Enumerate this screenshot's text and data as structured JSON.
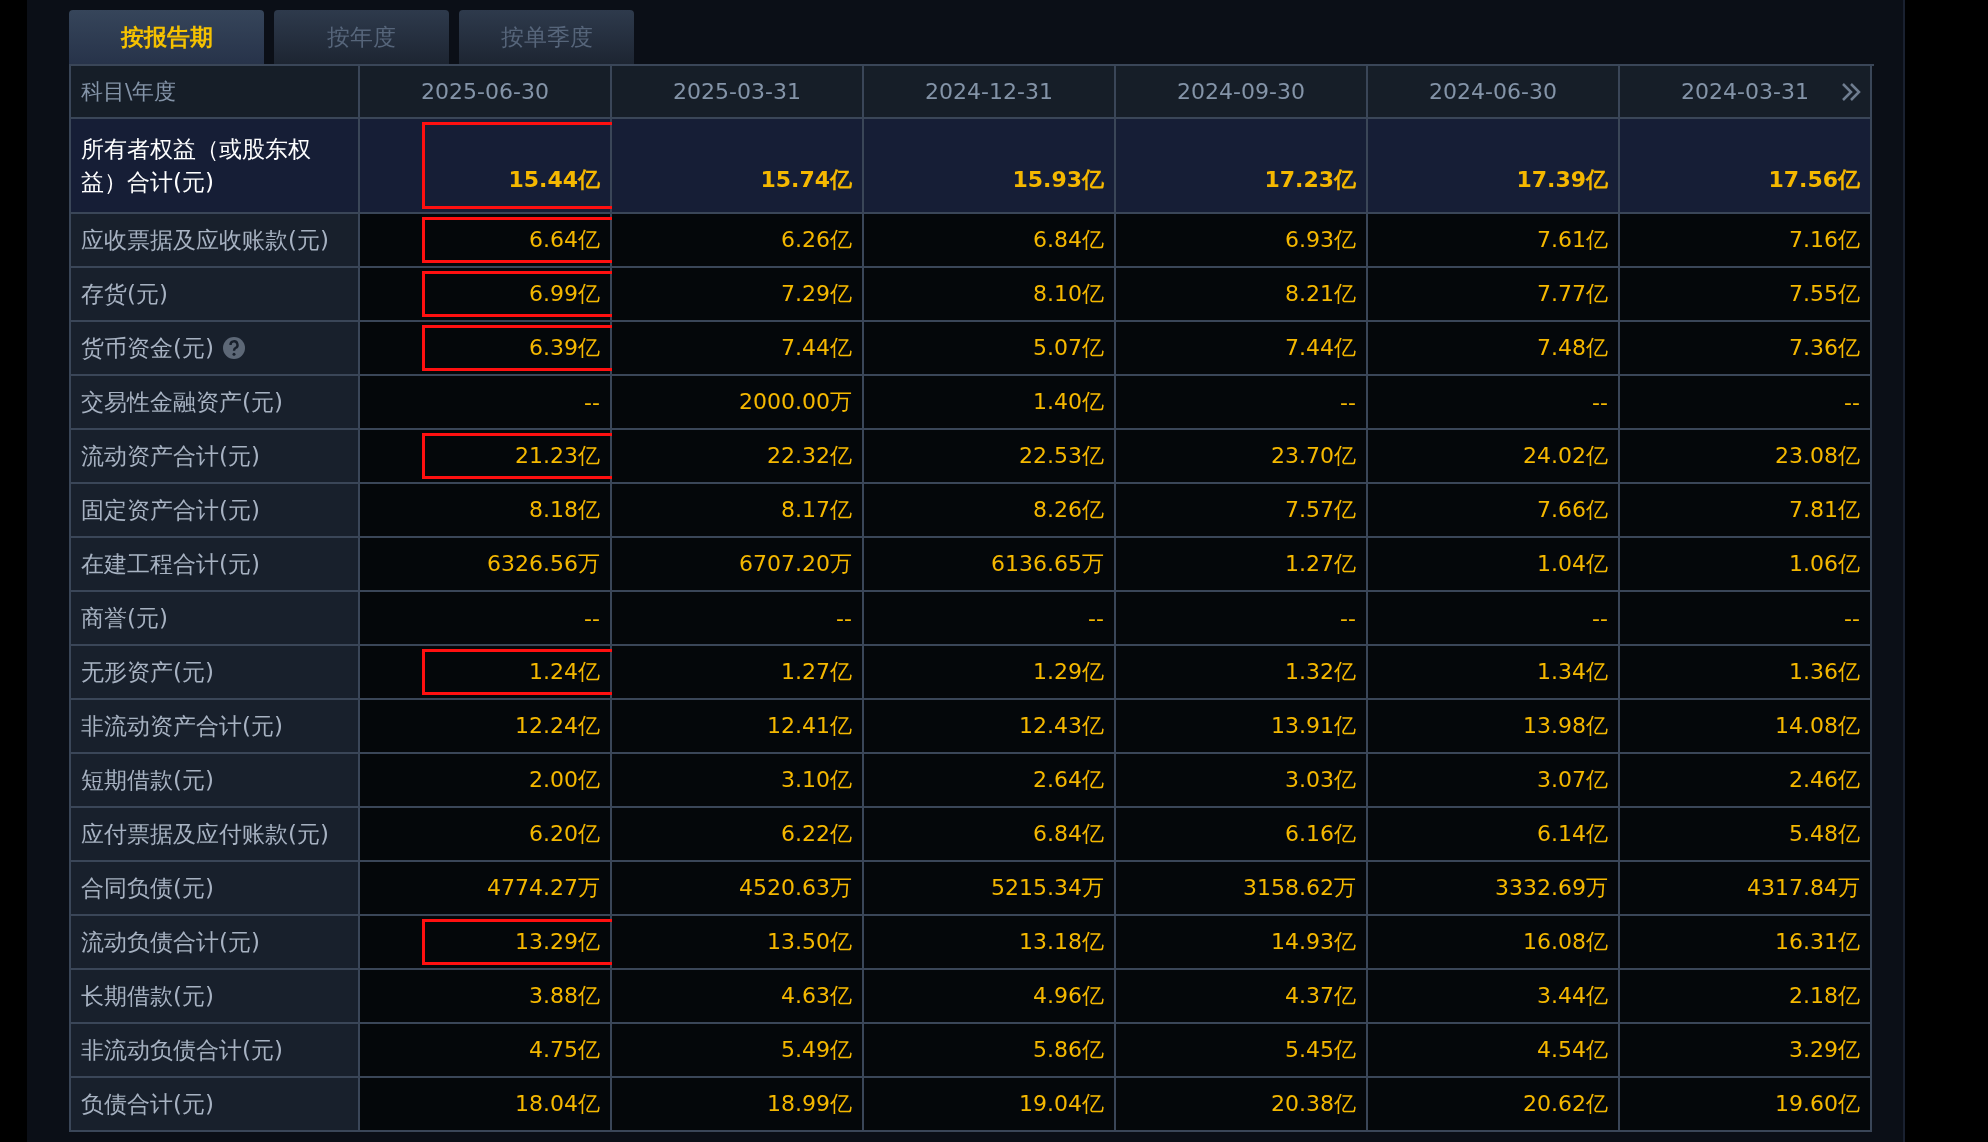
{
  "tabs": [
    {
      "label": "按报告期",
      "selected": true
    },
    {
      "label": "按年度",
      "selected": false
    },
    {
      "label": "按单季度",
      "selected": false
    }
  ],
  "table": {
    "corner": "科目\\年度",
    "columns": [
      "2025-06-30",
      "2025-03-31",
      "2024-12-31",
      "2024-09-30",
      "2024-06-30",
      "2024-03-31"
    ],
    "rows": [
      {
        "kind": "total",
        "label": "所有者权益（或股东权益）合计(元)",
        "help": false,
        "cells": [
          {
            "text": "15.44亿",
            "boxed": true
          },
          {
            "text": "15.74亿",
            "boxed": false
          },
          {
            "text": "15.93亿",
            "boxed": false
          },
          {
            "text": "17.23亿",
            "boxed": false
          },
          {
            "text": "17.39亿",
            "boxed": false
          },
          {
            "text": "17.56亿",
            "boxed": false
          }
        ]
      },
      {
        "kind": "item",
        "label": "应收票据及应收账款(元)",
        "help": false,
        "cells": [
          {
            "text": "6.64亿",
            "boxed": true
          },
          {
            "text": "6.26亿",
            "boxed": false
          },
          {
            "text": "6.84亿",
            "boxed": false
          },
          {
            "text": "6.93亿",
            "boxed": false
          },
          {
            "text": "7.61亿",
            "boxed": false
          },
          {
            "text": "7.16亿",
            "boxed": false
          }
        ]
      },
      {
        "kind": "item",
        "label": "存货(元)",
        "help": false,
        "cells": [
          {
            "text": "6.99亿",
            "boxed": true
          },
          {
            "text": "7.29亿",
            "boxed": false
          },
          {
            "text": "8.10亿",
            "boxed": false
          },
          {
            "text": "8.21亿",
            "boxed": false
          },
          {
            "text": "7.77亿",
            "boxed": false
          },
          {
            "text": "7.55亿",
            "boxed": false
          }
        ]
      },
      {
        "kind": "item",
        "label": "货币资金(元)",
        "help": true,
        "cells": [
          {
            "text": "6.39亿",
            "boxed": true
          },
          {
            "text": "7.44亿",
            "boxed": false
          },
          {
            "text": "5.07亿",
            "boxed": false
          },
          {
            "text": "7.44亿",
            "boxed": false
          },
          {
            "text": "7.48亿",
            "boxed": false
          },
          {
            "text": "7.36亿",
            "boxed": false
          }
        ]
      },
      {
        "kind": "item",
        "label": "交易性金融资产(元)",
        "help": false,
        "cells": [
          {
            "text": "--",
            "boxed": false
          },
          {
            "text": "2000.00万",
            "boxed": false
          },
          {
            "text": "1.40亿",
            "boxed": false
          },
          {
            "text": "--",
            "boxed": false
          },
          {
            "text": "--",
            "boxed": false
          },
          {
            "text": "--",
            "boxed": false
          }
        ]
      },
      {
        "kind": "item",
        "label": "流动资产合计(元)",
        "help": false,
        "cells": [
          {
            "text": "21.23亿",
            "boxed": true
          },
          {
            "text": "22.32亿",
            "boxed": false
          },
          {
            "text": "22.53亿",
            "boxed": false
          },
          {
            "text": "23.70亿",
            "boxed": false
          },
          {
            "text": "24.02亿",
            "boxed": false
          },
          {
            "text": "23.08亿",
            "boxed": false
          }
        ]
      },
      {
        "kind": "item",
        "label": "固定资产合计(元)",
        "help": false,
        "cells": [
          {
            "text": "8.18亿",
            "boxed": false
          },
          {
            "text": "8.17亿",
            "boxed": false
          },
          {
            "text": "8.26亿",
            "boxed": false
          },
          {
            "text": "7.57亿",
            "boxed": false
          },
          {
            "text": "7.66亿",
            "boxed": false
          },
          {
            "text": "7.81亿",
            "boxed": false
          }
        ]
      },
      {
        "kind": "item",
        "label": "在建工程合计(元)",
        "help": false,
        "cells": [
          {
            "text": "6326.56万",
            "boxed": false
          },
          {
            "text": "6707.20万",
            "boxed": false
          },
          {
            "text": "6136.65万",
            "boxed": false
          },
          {
            "text": "1.27亿",
            "boxed": false
          },
          {
            "text": "1.04亿",
            "boxed": false
          },
          {
            "text": "1.06亿",
            "boxed": false
          }
        ]
      },
      {
        "kind": "item",
        "label": "商誉(元)",
        "help": false,
        "cells": [
          {
            "text": "--",
            "boxed": false
          },
          {
            "text": "--",
            "boxed": false
          },
          {
            "text": "--",
            "boxed": false
          },
          {
            "text": "--",
            "boxed": false
          },
          {
            "text": "--",
            "boxed": false
          },
          {
            "text": "--",
            "boxed": false
          }
        ]
      },
      {
        "kind": "item",
        "label": "无形资产(元)",
        "help": false,
        "cells": [
          {
            "text": "1.24亿",
            "boxed": true
          },
          {
            "text": "1.27亿",
            "boxed": false
          },
          {
            "text": "1.29亿",
            "boxed": false
          },
          {
            "text": "1.32亿",
            "boxed": false
          },
          {
            "text": "1.34亿",
            "boxed": false
          },
          {
            "text": "1.36亿",
            "boxed": false
          }
        ]
      },
      {
        "kind": "item",
        "label": "非流动资产合计(元)",
        "help": false,
        "cells": [
          {
            "text": "12.24亿",
            "boxed": false
          },
          {
            "text": "12.41亿",
            "boxed": false
          },
          {
            "text": "12.43亿",
            "boxed": false
          },
          {
            "text": "13.91亿",
            "boxed": false
          },
          {
            "text": "13.98亿",
            "boxed": false
          },
          {
            "text": "14.08亿",
            "boxed": false
          }
        ]
      },
      {
        "kind": "item",
        "label": "短期借款(元)",
        "help": false,
        "cells": [
          {
            "text": "2.00亿",
            "boxed": false
          },
          {
            "text": "3.10亿",
            "boxed": false
          },
          {
            "text": "2.64亿",
            "boxed": false
          },
          {
            "text": "3.03亿",
            "boxed": false
          },
          {
            "text": "3.07亿",
            "boxed": false
          },
          {
            "text": "2.46亿",
            "boxed": false
          }
        ]
      },
      {
        "kind": "item",
        "label": "应付票据及应付账款(元)",
        "help": false,
        "cells": [
          {
            "text": "6.20亿",
            "boxed": false
          },
          {
            "text": "6.22亿",
            "boxed": false
          },
          {
            "text": "6.84亿",
            "boxed": false
          },
          {
            "text": "6.16亿",
            "boxed": false
          },
          {
            "text": "6.14亿",
            "boxed": false
          },
          {
            "text": "5.48亿",
            "boxed": false
          }
        ]
      },
      {
        "kind": "item",
        "label": "合同负债(元)",
        "help": false,
        "cells": [
          {
            "text": "4774.27万",
            "boxed": false
          },
          {
            "text": "4520.63万",
            "boxed": false
          },
          {
            "text": "5215.34万",
            "boxed": false
          },
          {
            "text": "3158.62万",
            "boxed": false
          },
          {
            "text": "3332.69万",
            "boxed": false
          },
          {
            "text": "4317.84万",
            "boxed": false
          }
        ]
      },
      {
        "kind": "item",
        "label": "流动负债合计(元)",
        "help": false,
        "cells": [
          {
            "text": "13.29亿",
            "boxed": true
          },
          {
            "text": "13.50亿",
            "boxed": false
          },
          {
            "text": "13.18亿",
            "boxed": false
          },
          {
            "text": "14.93亿",
            "boxed": false
          },
          {
            "text": "16.08亿",
            "boxed": false
          },
          {
            "text": "16.31亿",
            "boxed": false
          }
        ]
      },
      {
        "kind": "item",
        "label": "长期借款(元)",
        "help": false,
        "cells": [
          {
            "text": "3.88亿",
            "boxed": false
          },
          {
            "text": "4.63亿",
            "boxed": false
          },
          {
            "text": "4.96亿",
            "boxed": false
          },
          {
            "text": "4.37亿",
            "boxed": false
          },
          {
            "text": "3.44亿",
            "boxed": false
          },
          {
            "text": "2.18亿",
            "boxed": false
          }
        ]
      },
      {
        "kind": "item",
        "label": "非流动负债合计(元)",
        "help": false,
        "cells": [
          {
            "text": "4.75亿",
            "boxed": false
          },
          {
            "text": "5.49亿",
            "boxed": false
          },
          {
            "text": "5.86亿",
            "boxed": false
          },
          {
            "text": "5.45亿",
            "boxed": false
          },
          {
            "text": "4.54亿",
            "boxed": false
          },
          {
            "text": "3.29亿",
            "boxed": false
          }
        ]
      },
      {
        "kind": "item",
        "label": "负债合计(元)",
        "help": false,
        "cells": [
          {
            "text": "18.04亿",
            "boxed": false
          },
          {
            "text": "18.99亿",
            "boxed": false
          },
          {
            "text": "19.04亿",
            "boxed": false
          },
          {
            "text": "20.38亿",
            "boxed": false
          },
          {
            "text": "20.62亿",
            "boxed": false
          },
          {
            "text": "19.60亿",
            "boxed": false
          }
        ]
      }
    ]
  }
}
